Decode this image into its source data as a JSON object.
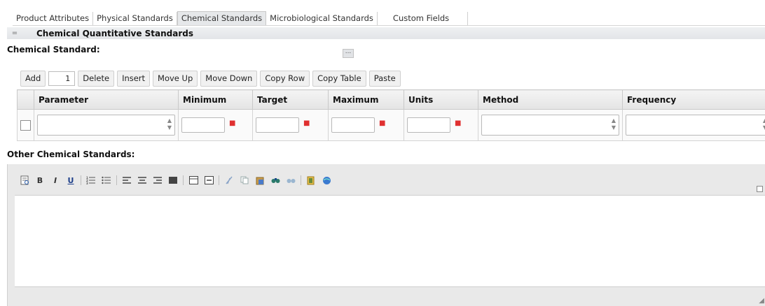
{
  "tabs": [
    {
      "label": "Product Attributes",
      "active": false
    },
    {
      "label": "Physical Standards",
      "active": false
    },
    {
      "label": "Chemical Standards",
      "active": true
    },
    {
      "label": "Microbiological Standards",
      "active": false
    },
    {
      "label": "Custom Fields",
      "active": false
    }
  ],
  "section": {
    "collapse_glyph": "=",
    "title": "Chemical Quantitative Standards"
  },
  "chemical_standard": {
    "label": "Chemical Standard:",
    "ellipsis": "..."
  },
  "toolbar": {
    "add": "Add",
    "count": "1",
    "delete": "Delete",
    "insert": "Insert",
    "move_up": "Move Up",
    "move_down": "Move Down",
    "copy_row": "Copy Row",
    "copy_table": "Copy Table",
    "paste": "Paste"
  },
  "table": {
    "columns": [
      "Parameter",
      "Minimum",
      "Target",
      "Maximum",
      "Units",
      "Method",
      "Frequency"
    ]
  },
  "other": {
    "label": "Other Chemical Standards:"
  },
  "editor": {
    "bold": "B",
    "italic": "I",
    "underline": "U"
  },
  "colors": {
    "required": "#e03030",
    "header_bg": "#e4e4e4",
    "editor_bg": "#e9e9e9"
  }
}
